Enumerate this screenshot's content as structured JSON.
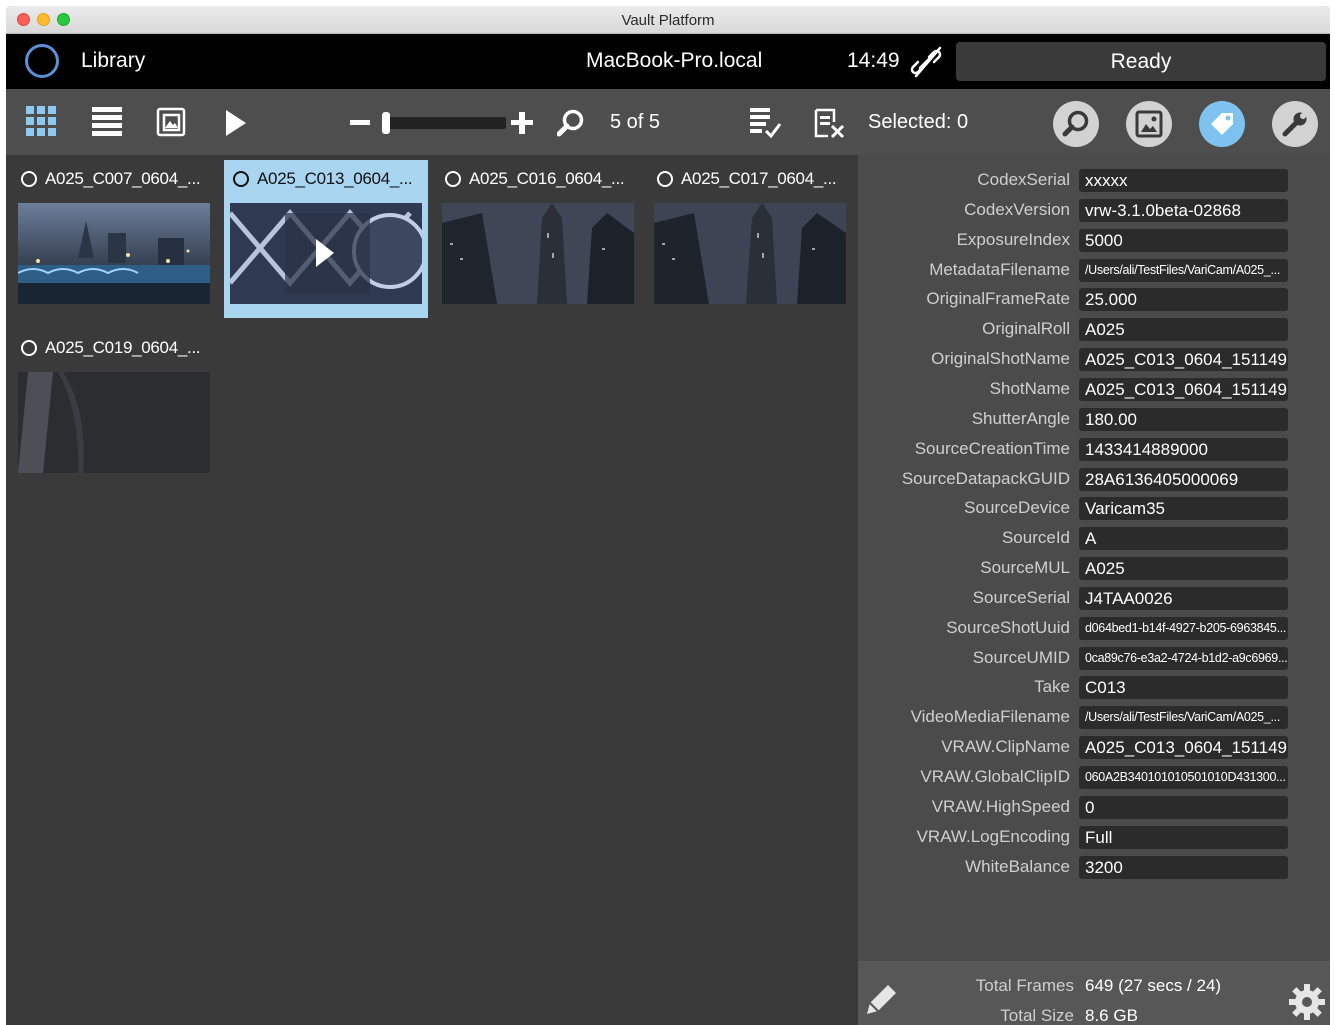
{
  "window": {
    "title": "Vault Platform"
  },
  "header": {
    "section": "Library",
    "host": "MacBook-Pro.local",
    "time": "14:49",
    "status": "Ready"
  },
  "toolbar": {
    "count": "5 of 5",
    "selected": "Selected: 0",
    "icons": [
      "grid-view-icon",
      "list-view-icon",
      "image-view-icon",
      "play-icon",
      "zoom-out-icon",
      "zoom-in-icon",
      "search-icon",
      "select-all-icon",
      "deselect-icon"
    ],
    "panel_buttons": [
      "search-panel-icon",
      "image-panel-icon",
      "tag-panel-icon",
      "wrench-panel-icon"
    ],
    "accent": "#7ec3ef"
  },
  "clips": [
    {
      "name": "A025_C007_0604_...",
      "selected": false
    },
    {
      "name": "A025_C013_0604_...",
      "selected": true
    },
    {
      "name": "A025_C016_0604_...",
      "selected": false
    },
    {
      "name": "A025_C017_0604_...",
      "selected": false
    },
    {
      "name": "A025_C019_0604_...",
      "selected": false
    }
  ],
  "metadata": [
    {
      "key": "CodexSerial",
      "value": "xxxxx"
    },
    {
      "key": "CodexVersion",
      "value": "vrw-3.1.0beta-02868"
    },
    {
      "key": "ExposureIndex",
      "value": "5000"
    },
    {
      "key": "MetadataFilename",
      "value": "/Users/ali/TestFiles/VariCam/A025_..."
    },
    {
      "key": "OriginalFrameRate",
      "value": "25.000"
    },
    {
      "key": "OriginalRoll",
      "value": "A025"
    },
    {
      "key": "OriginalShotName",
      "value": "A025_C013_0604_151149"
    },
    {
      "key": "ShotName",
      "value": "A025_C013_0604_151149"
    },
    {
      "key": "ShutterAngle",
      "value": "180.00"
    },
    {
      "key": "SourceCreationTime",
      "value": "1433414889000"
    },
    {
      "key": "SourceDatapackGUID",
      "value": "28A6136405000069"
    },
    {
      "key": "SourceDevice",
      "value": "Varicam35"
    },
    {
      "key": "SourceId",
      "value": "A"
    },
    {
      "key": "SourceMUL",
      "value": "A025"
    },
    {
      "key": "SourceSerial",
      "value": "J4TAA0026"
    },
    {
      "key": "SourceShotUuid",
      "value": "d064bed1-b14f-4927-b205-6963845..."
    },
    {
      "key": "SourceUMID",
      "value": "0ca89c76-e3a2-4724-b1d2-a9c6969..."
    },
    {
      "key": "Take",
      "value": "C013"
    },
    {
      "key": "VideoMediaFilename",
      "value": "/Users/ali/TestFiles/VariCam/A025_..."
    },
    {
      "key": "VRAW.ClipName",
      "value": "A025_C013_0604_151149"
    },
    {
      "key": "VRAW.GlobalClipID",
      "value": "060A2B340101010501010D431300..."
    },
    {
      "key": "VRAW.HighSpeed",
      "value": "0"
    },
    {
      "key": "VRAW.LogEncoding",
      "value": "Full"
    },
    {
      "key": "WhiteBalance",
      "value": "3200"
    }
  ],
  "footer": {
    "frames_label": "Total Frames",
    "frames_value": "649 (27 secs / 24)",
    "size_label": "Total Size",
    "size_value": "8.6 GB"
  }
}
